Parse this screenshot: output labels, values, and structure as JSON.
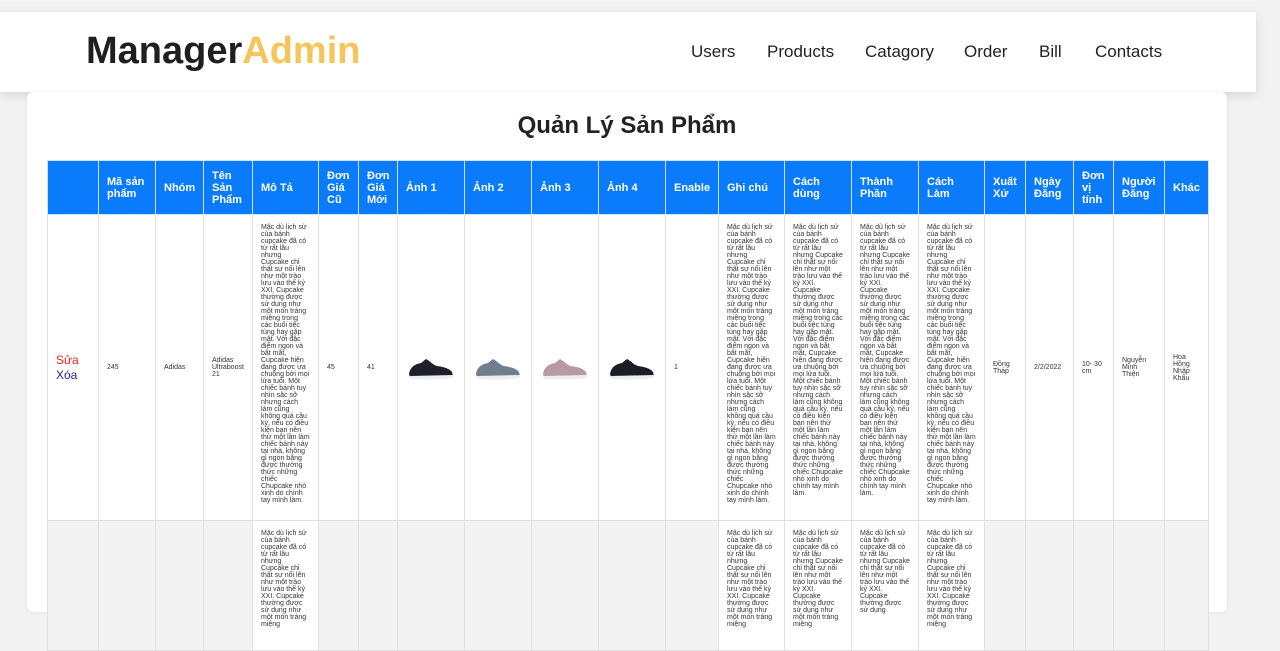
{
  "brand": {
    "part1": "Manager",
    "part2": "Admin"
  },
  "nav": [
    {
      "label": "Users"
    },
    {
      "label": "Products"
    },
    {
      "label": "Catagory"
    },
    {
      "label": "Order"
    },
    {
      "label": "Bill"
    },
    {
      "label": "Contacts"
    }
  ],
  "page_title": "Quản Lý Sản Phẩm",
  "columns": [
    "",
    "Mã sản phẩm",
    "Nhóm",
    "Tên Sản Phẩm",
    "Mô Tả",
    "Đơn Giá Cũ",
    "Đơn Giá Mới",
    "Ảnh 1",
    "Ảnh 2",
    "Ảnh 3",
    "Ảnh 4",
    "Enable",
    "Ghi chú",
    "Cách dùng",
    "Thành Phần",
    "Cách Làm",
    "Xuất Xứ",
    "Ngày Đăng",
    "Đơn vị tính",
    "Người Đăng",
    "Khác"
  ],
  "actions": {
    "edit": "Sửa",
    "delete": "Xóa"
  },
  "row1": {
    "id": "245",
    "group": "Adidas",
    "name": "Adidas Ultraboost 21",
    "desc": "Mặc dù lịch sử của bánh cupcake đã có từ rất lâu nhưng Cupcake chỉ thật sự nổi lên như một trào lưu vào thế kỷ XXI. Cupcake thường được sử dụng như một món tráng miệng trong các buổi tiệc tùng hay gặp mặt. Với đặc điểm ngon và bắt mắt, Cupcake hiện đang được ưa chuộng bởi mọi lứa tuổi. Một chiếc bánh tuy nhìn sặc sỡ nhưng cách làm cũng không quá cầu kỳ, nếu có điều kiện bạn nên thử một lần làm chiếc bánh này tại nhà, không gì ngon bằng được thưởng thức những chiếc Chupcake nhỏ xinh do chính tay mình làm.",
    "old_price": "45",
    "new_price": "41",
    "enable": "1",
    "note": "Mặc dù lịch sử của bánh cupcake đã có từ rất lâu nhưng Cupcake chỉ thật sự nổi lên như một trào lưu vào thế kỷ XXI. Cupcake thường được sử dụng như một món tráng miệng trong các buổi tiệc tùng hay gặp mặt. Với đặc điểm ngon và bắt mắt, Cupcake hiện đang được ưa chuộng bởi mọi lứa tuổi. Một chiếc bánh tuy nhìn sặc sỡ nhưng cách làm cũng không quá cầu kỳ, nếu có điều kiện bạn nên thử một lần làm chiếc bánh này tại nhà, không gì ngon bằng được thưởng thức những chiếc Chupcake nhỏ xinh do chính tay mình làm.",
    "usage": "Mặc dù lịch sử của bánh cupcake đã có từ rất lâu nhưng Cupcake chỉ thật sự nổi lên như một trào lưu vào thế kỷ XXI. Cupcake thường được sử dụng như một món tráng miệng trong các buổi tiệc tùng hay gặp mặt. Với đặc điểm ngon và bắt mắt, Cupcake hiện đang được ưa chuộng bởi mọi lứa tuổi. Một chiếc bánh tuy nhìn sặc sỡ nhưng cách làm cũng không quá cầu kỳ, nếu có điều kiện bạn nên thử một lần làm chiếc bánh này tại nhà, không gì ngon bằng được thưởng thức những chiếc Chupcake nhỏ xinh do chính tay mình làm.",
    "ingredients": "Mặc dù lịch sử của bánh cupcake đã có từ rất lâu nhưng Cupcake chỉ thật sự nổi lên như một trào lưu vào thế kỷ XXI. Cupcake thường được sử dụng như một món tráng miệng trong các buổi tiệc tùng hay gặp mặt. Với đặc điểm ngon và bắt mắt, Cupcake hiện đang được ưa chuộng bởi mọi lứa tuổi. Một chiếc bánh tuy nhìn sặc sỡ nhưng cách làm cũng không quá cầu kỳ, nếu có điều kiện bạn nên thử một lần làm chiếc bánh này tại nhà, không gì ngon bằng được thưởng thức những chiếc Chupcake nhỏ xinh do chính tay mình làm.",
    "method": "Mặc dù lịch sử của bánh cupcake đã có từ rất lâu nhưng Cupcake chỉ thật sự nổi lên như một trào lưu vào thế kỷ XXI. Cupcake thường được sử dụng như một món tráng miệng trong các buổi tiệc tùng hay gặp mặt. Với đặc điểm ngon và bắt mắt, Cupcake hiện đang được ưa chuộng bởi mọi lứa tuổi. Một chiếc bánh tuy nhìn sặc sỡ nhưng cách làm cũng không quá cầu kỳ, nếu có điều kiện bạn nên thử một lần làm chiếc bánh này tại nhà, không gì ngon bằng được thưởng thức những chiếc Chupcake nhỏ xinh do chính tay mình làm.",
    "origin": "Đồng Tháp",
    "date": "2/2/2022",
    "unit": "10- 30 cm",
    "author": "Nguyễn Minh Thiện",
    "other": "Hoa Hồng Nhập Khẩu"
  },
  "row2": {
    "desc": "Mặc dù lịch sử của bánh cupcake đã có từ rất lâu nhưng Cupcake chỉ thật sự nổi lên như một trào lưu vào thế kỷ XXI. Cupcake thường được sử dụng như một món tráng miệng",
    "note": "Mặc dù lịch sử của bánh cupcake đã có từ rất lâu nhưng Cupcake chỉ thật sự nổi lên như một trào lưu vào thế kỷ XXI. Cupcake thường được sử dụng như một món tráng miệng",
    "usage": "Mặc dù lịch sử của bánh cupcake đã có từ rất lâu nhưng Cupcake chỉ thật sự nổi lên như một trào lưu vào thế kỷ XXI. Cupcake thường được sử dụng như một món tráng miệng",
    "ingredients": "Mặc dù lịch sử của bánh cupcake đã có từ rất lâu nhưng Cupcake chỉ thật sự nổi lên như một trào lưu vào thế kỷ XXI. Cupcake thường được sử dụng",
    "method": "Mặc dù lịch sử của bánh cupcake đã có từ rất lâu nhưng Cupcake chỉ thật sự nổi lên như một trào lưu vào thế kỷ XXI. Cupcake thường được sử dụng như một món tráng miệng"
  },
  "shoe_colors": [
    "#1d1f2a",
    "#6f7d8c",
    "#b89aa6",
    "#1b1d26"
  ]
}
